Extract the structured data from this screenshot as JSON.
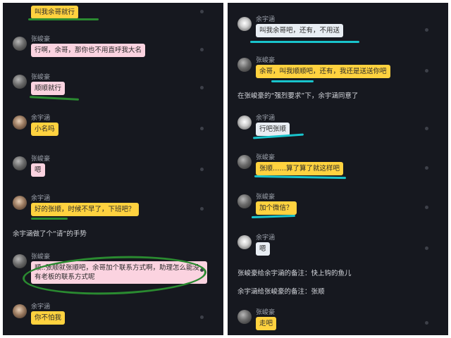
{
  "left": {
    "messages": [
      {
        "name": "",
        "text": "叫我余哥就行",
        "color": "yellow"
      },
      {
        "name": "张峻豪",
        "text": "行啊，余哥，那你也不用直呼我大名",
        "color": "pink"
      },
      {
        "name": "张峻豪",
        "text": "顺顺就行",
        "color": "pink"
      },
      {
        "name": "余宇涵",
        "text": "小名吗",
        "color": "yellow"
      },
      {
        "name": "张峻豪",
        "text": "嗯",
        "color": "pink"
      },
      {
        "name": "余宇涵",
        "text": "好的张顺，时候不早了，下班吧？",
        "color": "yellow"
      },
      {
        "system": "余宇涵做了个“请”的手势"
      },
      {
        "name": "张峻豪",
        "text": "顺..张顺就张顺吧，余哥加个联系方式啊，助理怎么能没有老板的联系方式呢",
        "color": "pink"
      },
      {
        "name": "余宇涵",
        "text": "你不怕我",
        "color": "yellow"
      }
    ]
  },
  "right": {
    "messages": [
      {
        "name": "余宇涵",
        "text": "叫我余哥吧，还有，不用送",
        "color": "white"
      },
      {
        "name": "张峻豪",
        "text": "余哥，叫我顺顺吧，还有，我还是送送你吧",
        "color": "yellow"
      },
      {
        "system": "在张峻豪的“强烈要求”下，余宇涵同意了"
      },
      {
        "name": "余宇涵",
        "text": "行吧张顺",
        "color": "white"
      },
      {
        "name": "张峻豪",
        "text": "张顺……算了算了就这样吧",
        "color": "yellow"
      },
      {
        "name": "张峻豪",
        "text": "加个微信？",
        "color": "yellow"
      },
      {
        "name": "余宇涵",
        "text": "嗯",
        "color": "white"
      },
      {
        "system": "张峻豪给余宇涵的备注：快上钩的鱼儿"
      },
      {
        "system": "余宇涵给张峻豪的备注：张顺"
      },
      {
        "name": "张峻豪",
        "text": "走吧",
        "color": "yellow"
      }
    ]
  },
  "colors": {
    "panel_bg": "#16181f",
    "bubble_yellow": "#ffd23f",
    "bubble_pink": "#fbd3e0",
    "bubble_white": "#e8edf3",
    "highlight_green": "#2a8a30",
    "highlight_cyan": "#19c4cc"
  }
}
